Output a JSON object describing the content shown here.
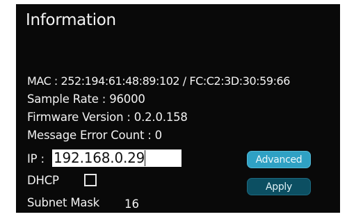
{
  "panel": {
    "title": "Information"
  },
  "info": {
    "mac": "MAC : 252:194:61:48:89:102 / FC:C2:3D:30:59:66",
    "sample_rate": "Sample Rate : 96000",
    "firmware": "Firmware Version : 0.2.0.158",
    "error_count": "Message Error Count : 0"
  },
  "ip": {
    "label": "IP :",
    "value": "192.168.0.29"
  },
  "dhcp": {
    "label": "DHCP",
    "checked": false
  },
  "subnet": {
    "label": "Subnet Mask",
    "value": "16"
  },
  "buttons": {
    "advanced": "Advanced",
    "apply": "Apply"
  },
  "colors": {
    "panel_background": "#090909",
    "advanced_button": "#2fa1c4",
    "apply_button": "#0c4f62"
  }
}
